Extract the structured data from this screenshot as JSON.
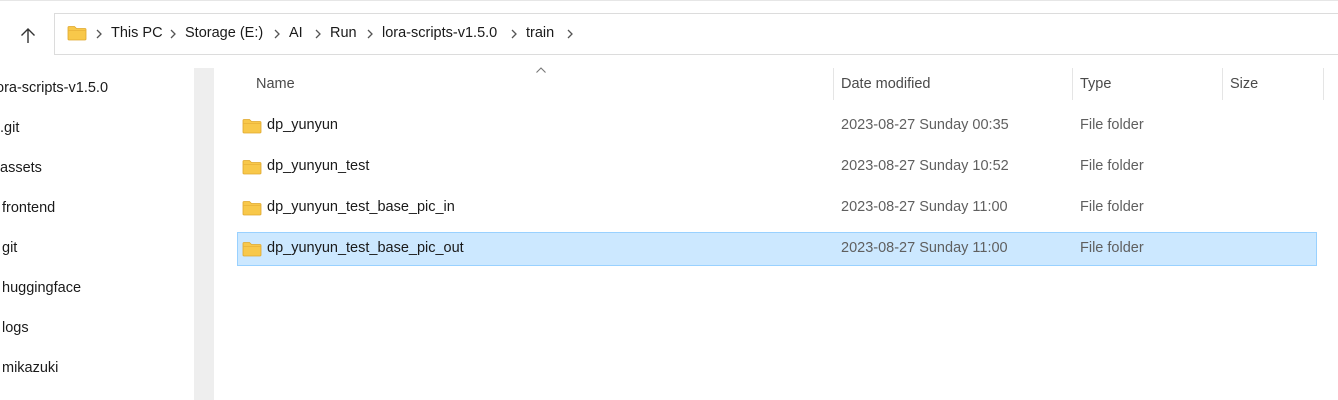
{
  "toolbar": {
    "up_icon": "arrow-up-icon"
  },
  "address": {
    "root_icon": "folder-icon",
    "crumbs": [
      "This PC",
      "Storage (E:)",
      "AI",
      "Run",
      "lora-scripts-v1.5.0",
      "train"
    ],
    "separator_icon": "chevron-right-icon"
  },
  "nav": {
    "items": [
      "ora-scripts-v1.5.0",
      ".git",
      "assets",
      "frontend",
      "git",
      "huggingface",
      "logs",
      "mikazuki"
    ]
  },
  "columns": {
    "name": "Name",
    "date": "Date modified",
    "type": "Type",
    "size": "Size",
    "sort_icon": "sort-ascending-icon"
  },
  "files": [
    {
      "name": "dp_yunyun",
      "date": "2023-08-27 Sunday 00:35",
      "type": "File folder",
      "selected": false
    },
    {
      "name": "dp_yunyun_test",
      "date": "2023-08-27 Sunday 10:52",
      "type": "File folder",
      "selected": false
    },
    {
      "name": "dp_yunyun_test_base_pic_in",
      "date": "2023-08-27 Sunday 11:00",
      "type": "File folder",
      "selected": false
    },
    {
      "name": "dp_yunyun_test_base_pic_out",
      "date": "2023-08-27 Sunday 11:00",
      "type": "File folder",
      "selected": true
    }
  ],
  "colors": {
    "selection_bg": "#cce8ff",
    "selection_border": "#99d1ff",
    "folder_yellow": "#f8c84a"
  }
}
